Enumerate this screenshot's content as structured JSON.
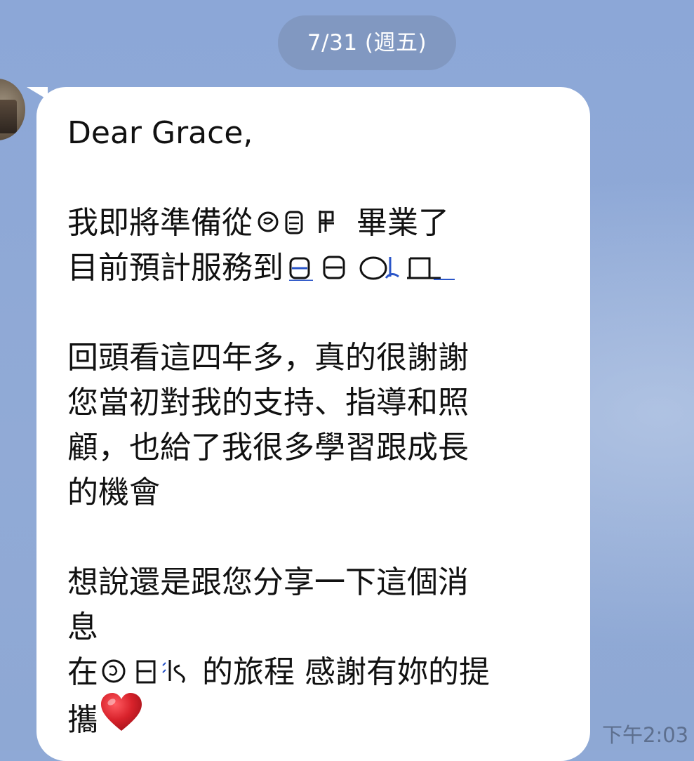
{
  "date_separator": "7/31 (週五)",
  "message": {
    "greeting": "Dear Grace,",
    "p1_line1_start": "我即將準備從",
    "p1_line1_end": "畢業了",
    "p1_line2_start": "目前預計服務到",
    "p2_line1": "回頭看這四年多，真的很謝謝",
    "p2_line2": "您當初對我的支持、指導和照",
    "p2_line3": "顧，也給了我很多學習跟成長",
    "p2_line4": "的機會",
    "p3_line1": "想說還是跟您分享一下這個消",
    "p3_line2": "息",
    "p3_line3_start": "在",
    "p3_line3_end": "的旅程 感謝有妳的提",
    "p3_line4": "攜",
    "emoji": "red-heart-icon"
  },
  "timestamp": "下午2:03",
  "colors": {
    "chat_background": "#8fa9d6",
    "bubble": "#ffffff",
    "text": "#111111",
    "date_pill": "#7d8fb3",
    "heart": "#d8222b"
  }
}
